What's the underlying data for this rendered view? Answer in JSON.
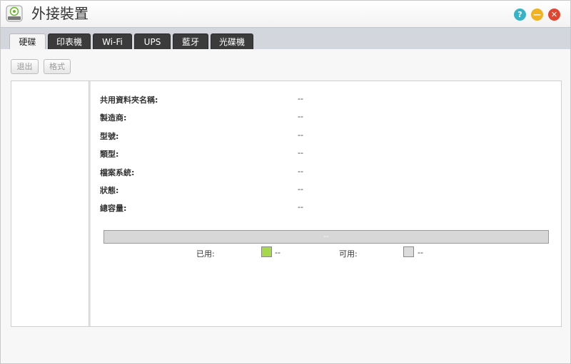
{
  "window": {
    "title": "外接裝置",
    "icon": "external-drive-icon",
    "controls": {
      "help": "?",
      "minimize": "—",
      "close": "✕"
    }
  },
  "tabs": [
    {
      "label": "硬碟",
      "active": true
    },
    {
      "label": "印表機",
      "active": false
    },
    {
      "label": "Wi-Fi",
      "active": false
    },
    {
      "label": "UPS",
      "active": false
    },
    {
      "label": "藍牙",
      "active": false
    },
    {
      "label": "光碟機",
      "active": false
    }
  ],
  "toolbar": {
    "eject_label": "退出",
    "format_label": "格式"
  },
  "properties": [
    {
      "label": "共用資料夾名稱:",
      "value": "--"
    },
    {
      "label": "製造商:",
      "value": "--"
    },
    {
      "label": "型號:",
      "value": "--"
    },
    {
      "label": "類型:",
      "value": "--"
    },
    {
      "label": "檔案系統:",
      "value": "--"
    },
    {
      "label": "狀態:",
      "value": "--"
    },
    {
      "label": "總容量:",
      "value": "--"
    }
  ],
  "usage": {
    "bar_text": "--",
    "used_label": "已用:",
    "used_value": "--",
    "used_color": "#a6d94a",
    "free_label": "可用:",
    "free_value": "--",
    "free_color": "#dcdcdc"
  }
}
